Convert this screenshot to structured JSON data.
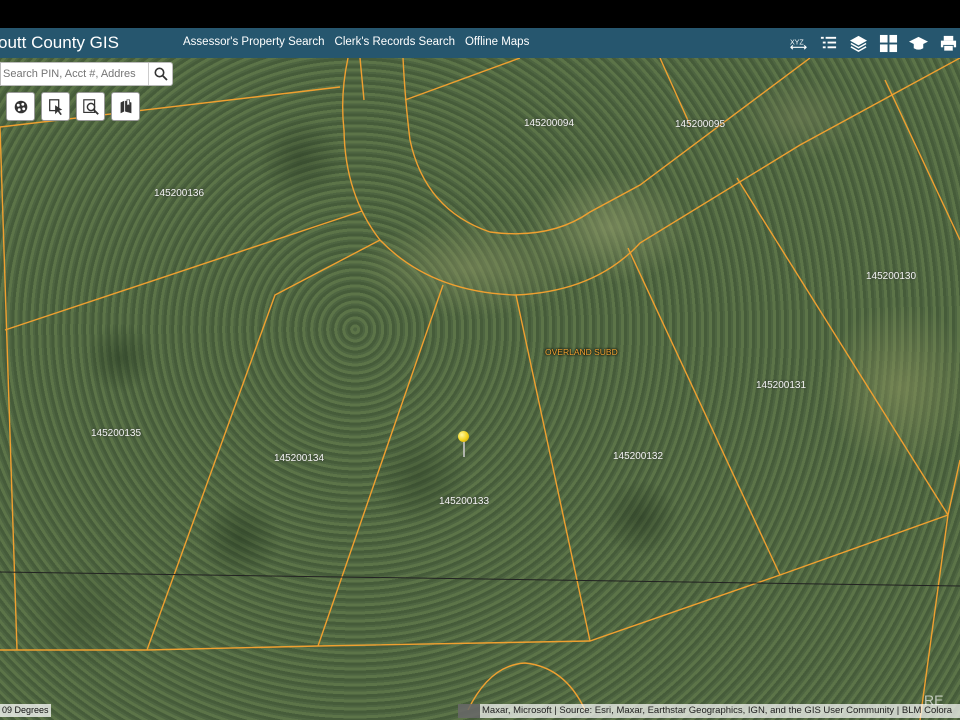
{
  "app": {
    "title": "outt County GIS"
  },
  "nav": {
    "links": [
      "Assessor's Property Search",
      "Clerk's Records Search",
      "Offline Maps"
    ]
  },
  "toolbar": {
    "icons": [
      "xyz-coordinates-icon",
      "list-icon",
      "layers-icon",
      "basemap-grid-icon",
      "graduation-cap-icon",
      "print-icon"
    ],
    "xyz_label": "XYZ"
  },
  "search": {
    "placeholder": "Search PIN, Acct #, Addres"
  },
  "map_tools": [
    "select-parcels-icon",
    "identify-icon",
    "search-map-icon",
    "bookmark-icon"
  ],
  "parcels": [
    {
      "pin": "145200094"
    },
    {
      "pin": "145200095"
    },
    {
      "pin": "145200136"
    },
    {
      "pin": "145200130"
    },
    {
      "pin": "145200131"
    },
    {
      "pin": "145200135"
    },
    {
      "pin": "145200134"
    },
    {
      "pin": "145200132"
    },
    {
      "pin": "145200133"
    }
  ],
  "subdivision_label": "OVERLAND SUBD",
  "scale_text": "09 Degrees",
  "attribution": "Maxar, Microsoft | Source: Esri, Maxar, Earthstar Geographics, IGN, and the GIS User Community | BLM Colora",
  "watermark": "RE",
  "colors": {
    "header": "#26566e",
    "parcel_line": "#f0a030",
    "pin_marker": "#f2d21a"
  }
}
